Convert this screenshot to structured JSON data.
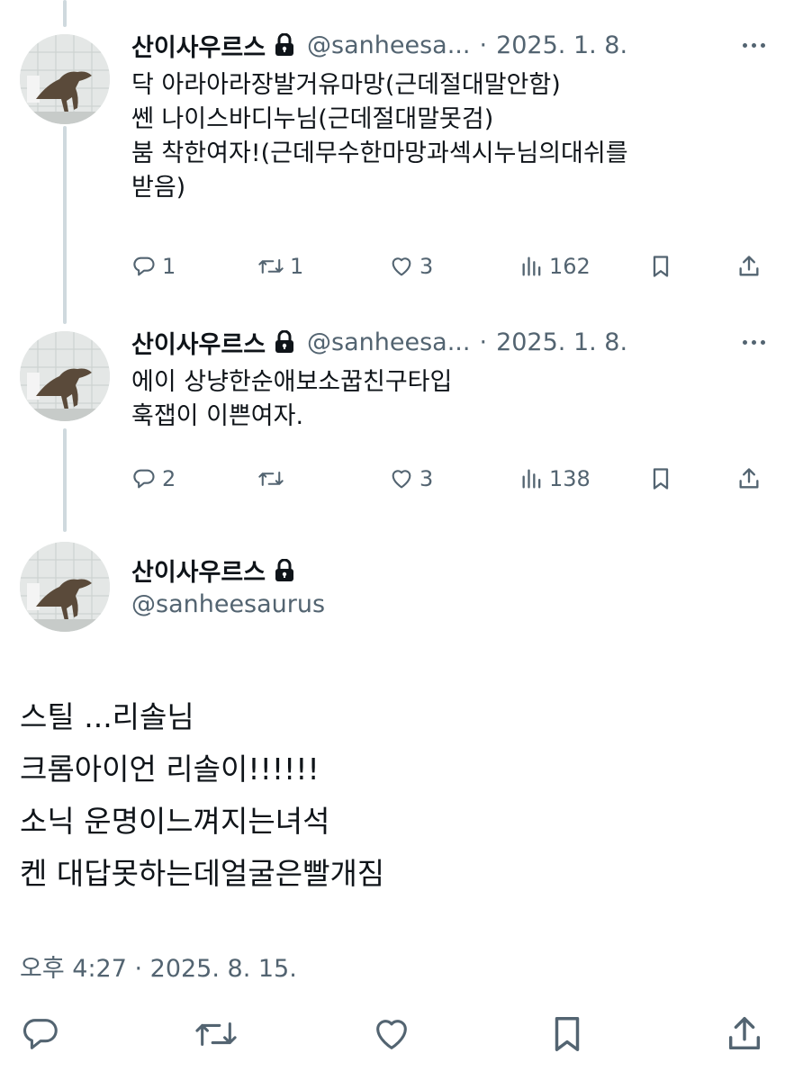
{
  "tweets": [
    {
      "name": "산이사우르스",
      "handle": "@sanheesa...",
      "separator": "·",
      "date": "2025. 1. 8.",
      "lines": [
        "닥 아라아라장발거유마망(근데절대말안함)",
        "쎈 나이스바디누님(근데절대말못검)",
        "붐 착한여자!(근데무수한마망과섹시누님의대쉬를",
        "받음)"
      ],
      "replies": "1",
      "retweets": "1",
      "likes": "3",
      "views": "162"
    },
    {
      "name": "산이사우르스",
      "handle": "@sanheesa...",
      "separator": "·",
      "date": "2025. 1. 8.",
      "lines": [
        "에이 상냥한순애보소꿉친구타입",
        "훅잽이 이쁜여자."
      ],
      "replies": "2",
      "retweets": "",
      "likes": "3",
      "views": "138"
    }
  ],
  "main_tweet": {
    "name": "산이사우르스",
    "handle": "@sanheesaurus",
    "lines": [
      "스틸 ...리솔님",
      "크롬아이언 리솔이!!!!!!",
      "소닉 운명이느껴지는녀석",
      "켄 대답못하는데얼굴은빨개짐"
    ],
    "timestamp": "오후 4:27 · 2025. 8. 15."
  },
  "icons": {
    "reply": "reply-icon",
    "retweet": "retweet-icon",
    "like": "heart-icon",
    "views": "views-icon",
    "bookmark": "bookmark-icon",
    "share": "share-icon",
    "lock": "lock-icon",
    "more": "more-icon"
  },
  "colors": {
    "text": "#0f1419",
    "secondary": "#536471",
    "thread_line": "#cfd9de"
  }
}
